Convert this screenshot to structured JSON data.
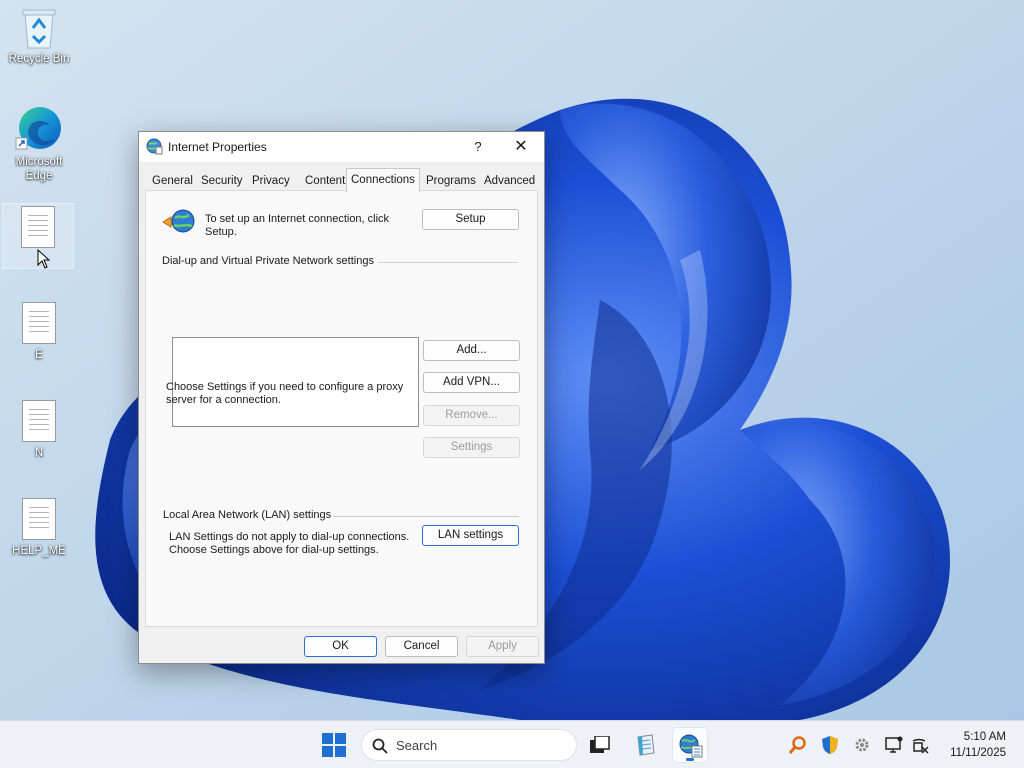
{
  "desktop": {
    "icons": [
      {
        "label": "Recycle Bin",
        "icon": "recycle-bin-icon"
      },
      {
        "label": "Microsoft Edge",
        "icon": "edge-icon"
      },
      {
        "label": "",
        "icon": "text-file-icon"
      },
      {
        "label": "E",
        "icon": "text-file-icon"
      },
      {
        "label": "N",
        "icon": "text-file-icon"
      },
      {
        "label": "HELP_ME",
        "icon": "text-file-icon"
      }
    ]
  },
  "dialog": {
    "title": "Internet Properties",
    "help": "?",
    "close": "✕",
    "tabs": [
      "General",
      "Security",
      "Privacy",
      "Content",
      "Connections",
      "Programs",
      "Advanced"
    ],
    "active_tab": "Connections",
    "setup_text": "To set up an Internet connection, click Setup.",
    "setup_button": "Setup",
    "vpn_section_title": "Dial-up and Virtual Private Network settings",
    "add_button": "Add...",
    "add_vpn_button": "Add VPN...",
    "remove_button": "Remove...",
    "settings_text": "Choose Settings if you need to configure a proxy server for a connection.",
    "settings_button": "Settings",
    "lan_section_title": "Local Area Network (LAN) settings",
    "lan_text": "LAN Settings do not apply to dial-up connections. Choose Settings above for dial-up settings.",
    "lan_button": "LAN settings",
    "ok_button": "OK",
    "cancel_button": "Cancel",
    "apply_button": "Apply"
  },
  "taskbar": {
    "search_placeholder": "Search",
    "time": "5:10 AM",
    "date": "11/11/2025"
  },
  "colors": {
    "accent": "#1f6fd2",
    "wallpaper_bg": "#b9d3ea",
    "wallpaper_bloom": "#1c4fd6"
  }
}
